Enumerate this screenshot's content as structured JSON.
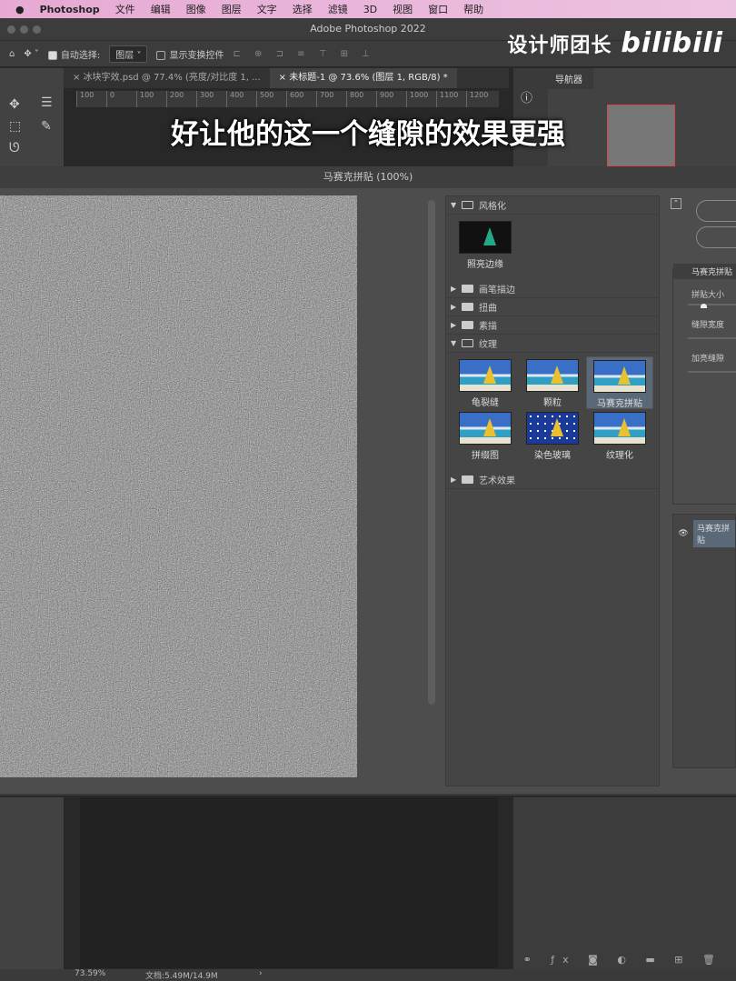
{
  "menubar": {
    "app": "Photoshop",
    "items": [
      "文件",
      "编辑",
      "图像",
      "图层",
      "文字",
      "选择",
      "滤镜",
      "3D",
      "视图",
      "窗口",
      "帮助"
    ]
  },
  "window": {
    "title": "Adobe Photoshop 2022"
  },
  "options": {
    "auto_select_label": "自动选择:",
    "auto_select_value": "图层",
    "show_transform_label": "显示变换控件"
  },
  "watermark": {
    "channel": "设计师团长",
    "logo": "bilibili"
  },
  "tabs": [
    {
      "label": "冰块字效.psd @ 77.4% (亮度/对比度 1, ..."
    },
    {
      "label": "未标题-1 @ 73.6% (图层 1, RGB/8) *"
    }
  ],
  "ruler": [
    "100",
    "0",
    "100",
    "200",
    "300",
    "400",
    "500",
    "600",
    "700",
    "800",
    "900",
    "1000",
    "1100",
    "1200"
  ],
  "navigator": {
    "title": "导航器"
  },
  "subtitle": "好让他的这一个缝隙的效果更强",
  "dialog": {
    "title": "马赛克拼贴 (100%)"
  },
  "gallery": {
    "stylize": {
      "label": "风格化",
      "filters": [
        "照亮边缘"
      ]
    },
    "collapsed1": [
      "画笔描边",
      "扭曲",
      "素描"
    ],
    "texture": {
      "label": "纹理",
      "filters": [
        "龟裂缝",
        "颗粒",
        "马赛克拼贴",
        "拼缀图",
        "染色玻璃",
        "纹理化"
      ],
      "selected": "马赛克拼贴"
    },
    "collapsed2": [
      "艺术效果"
    ]
  },
  "params": {
    "title": "马赛克拼贴",
    "tile_size": "拼贴大小",
    "grout_width": "缝隙宽度",
    "lighten_grout": "加亮缝隙"
  },
  "effect_layer": "马赛克拼贴",
  "status": {
    "zoom": "73.59%",
    "doc": "文档:5.49M/14.9M"
  }
}
